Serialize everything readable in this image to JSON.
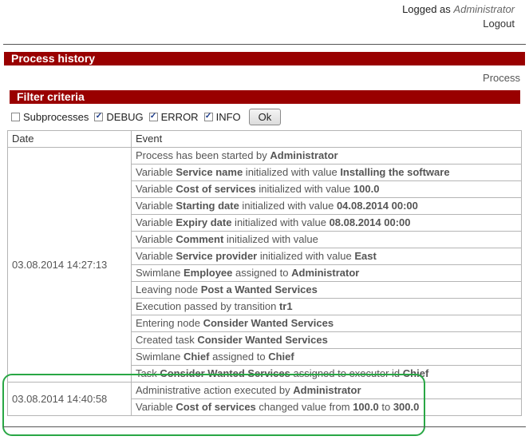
{
  "header": {
    "logged_as_prefix": "Logged as",
    "user_name": "Administrator",
    "logout_label": "Logout"
  },
  "process_section": {
    "title": "Process history",
    "process_link": "Process"
  },
  "filter_section": {
    "title": "Filter criteria",
    "options": [
      {
        "label": "Subprocesses",
        "checked": false
      },
      {
        "label": "DEBUG",
        "checked": true
      },
      {
        "label": "ERROR",
        "checked": true
      },
      {
        "label": "INFO",
        "checked": true
      }
    ],
    "ok_label": "Ok"
  },
  "table": {
    "columns": [
      "Date",
      "Event"
    ],
    "groups": [
      {
        "date": "03.08.2014 14:27:13",
        "events": [
          [
            {
              "t": "Process has been started by "
            },
            {
              "b": "Administrator"
            }
          ],
          [
            {
              "t": "Variable "
            },
            {
              "b": "Service name"
            },
            {
              "t": " initialized with value "
            },
            {
              "b": "Installing the software"
            }
          ],
          [
            {
              "t": "Variable "
            },
            {
              "b": "Cost of services"
            },
            {
              "t": " initialized with value "
            },
            {
              "b": "100.0"
            }
          ],
          [
            {
              "t": "Variable "
            },
            {
              "b": "Starting date"
            },
            {
              "t": " initialized with value "
            },
            {
              "b": "04.08.2014 00:00"
            }
          ],
          [
            {
              "t": "Variable "
            },
            {
              "b": "Expiry date"
            },
            {
              "t": " initialized with value "
            },
            {
              "b": "08.08.2014 00:00"
            }
          ],
          [
            {
              "t": "Variable "
            },
            {
              "b": "Comment"
            },
            {
              "t": " initialized with value"
            }
          ],
          [
            {
              "t": "Variable "
            },
            {
              "b": "Service provider"
            },
            {
              "t": " initialized with value "
            },
            {
              "b": "East"
            }
          ],
          [
            {
              "t": "Swimlane "
            },
            {
              "b": "Employee"
            },
            {
              "t": " assigned to "
            },
            {
              "b": "Administrator"
            }
          ],
          [
            {
              "t": "Leaving node "
            },
            {
              "b": "Post a Wanted Services"
            }
          ],
          [
            {
              "t": "Execution passed by transition "
            },
            {
              "b": "tr1"
            }
          ],
          [
            {
              "t": "Entering node "
            },
            {
              "b": "Consider Wanted Services"
            }
          ],
          [
            {
              "t": "Created task "
            },
            {
              "b": "Consider Wanted Services"
            }
          ],
          [
            {
              "t": "Swimlane "
            },
            {
              "b": "Chief"
            },
            {
              "t": " assigned to "
            },
            {
              "b": "Chief"
            }
          ],
          [
            {
              "t": "Task "
            },
            {
              "b": "Consider Wanted Services"
            },
            {
              "t": " assigned to executor id "
            },
            {
              "b": "Chief"
            }
          ]
        ]
      },
      {
        "date": "03.08.2014 14:40:58",
        "events": [
          [
            {
              "t": "Administrative action executed by "
            },
            {
              "b": "Administrator"
            }
          ],
          [
            {
              "t": "Variable "
            },
            {
              "b": "Cost of services"
            },
            {
              "t": " changed value from "
            },
            {
              "b": "100.0"
            },
            {
              "t": " to "
            },
            {
              "b": "300.0"
            }
          ]
        ]
      }
    ]
  },
  "colors": {
    "section_bar": "#990000",
    "highlight": "#29a745"
  }
}
